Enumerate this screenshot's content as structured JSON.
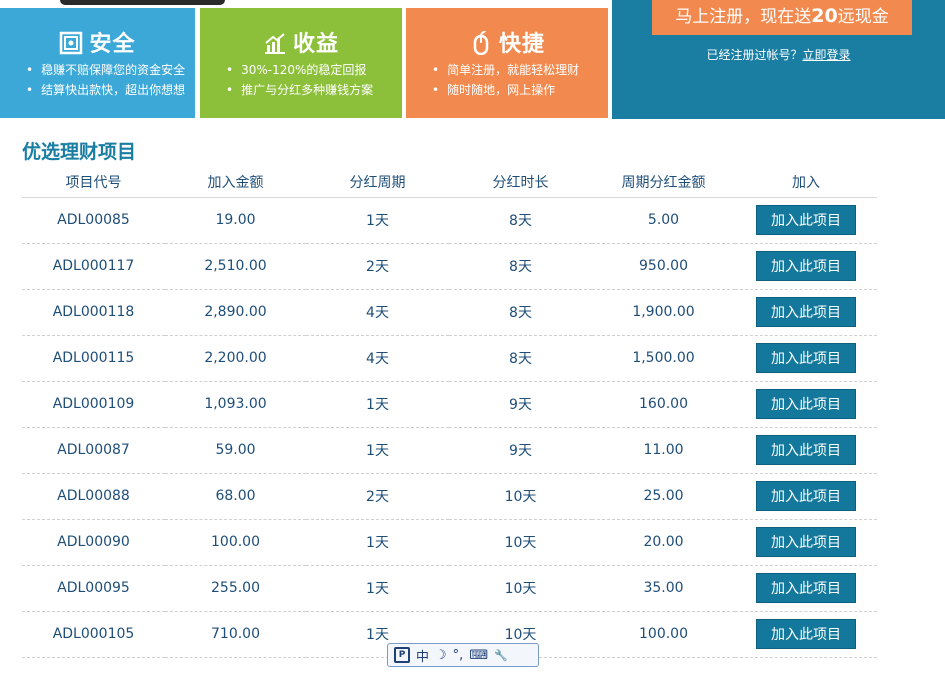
{
  "cards": [
    {
      "title": "安全",
      "icon": "safe-icon",
      "items": [
        "稳赚不赔保障您的资金安全",
        "结算快出款快，超出你想想"
      ]
    },
    {
      "title": "收益",
      "icon": "chart-icon",
      "items": [
        "30%-120%的稳定回报",
        "推广与分红多种赚钱方案"
      ]
    },
    {
      "title": "快捷",
      "icon": "mouse-icon",
      "items": [
        "简单注册，就能轻松理财",
        "随时随地，网上操作"
      ]
    }
  ],
  "register": {
    "button_prefix": "马上注册，现在送",
    "button_amount": "20",
    "button_suffix": "远现金",
    "login_prompt": "已经注册过帐号？",
    "login_link": "立即登录"
  },
  "section_title": "优选理财项目",
  "table": {
    "headers": [
      "项目代号",
      "加入金额",
      "分红周期",
      "分红时长",
      "周期分红金额",
      "加入"
    ],
    "join_label": "加入此项目",
    "rows": [
      [
        "ADL00085",
        "19.00",
        "1天",
        "8天",
        "5.00"
      ],
      [
        "ADL000117",
        "2,510.00",
        "2天",
        "8天",
        "950.00"
      ],
      [
        "ADL000118",
        "2,890.00",
        "4天",
        "8天",
        "1,900.00"
      ],
      [
        "ADL000115",
        "2,200.00",
        "4天",
        "8天",
        "1,500.00"
      ],
      [
        "ADL000109",
        "1,093.00",
        "1天",
        "9天",
        "160.00"
      ],
      [
        "ADL00087",
        "59.00",
        "1天",
        "9天",
        "11.00"
      ],
      [
        "ADL00088",
        "68.00",
        "2天",
        "10天",
        "25.00"
      ],
      [
        "ADL00090",
        "100.00",
        "1天",
        "10天",
        "20.00"
      ],
      [
        "ADL00095",
        "255.00",
        "1天",
        "10天",
        "35.00"
      ],
      [
        "ADL000105",
        "710.00",
        "1天",
        "10天",
        "100.00"
      ]
    ]
  },
  "ime": {
    "mode": "中",
    "moon": "☽",
    "punct": "°,",
    "keyboard": "⌨",
    "tools": "🔧"
  }
}
